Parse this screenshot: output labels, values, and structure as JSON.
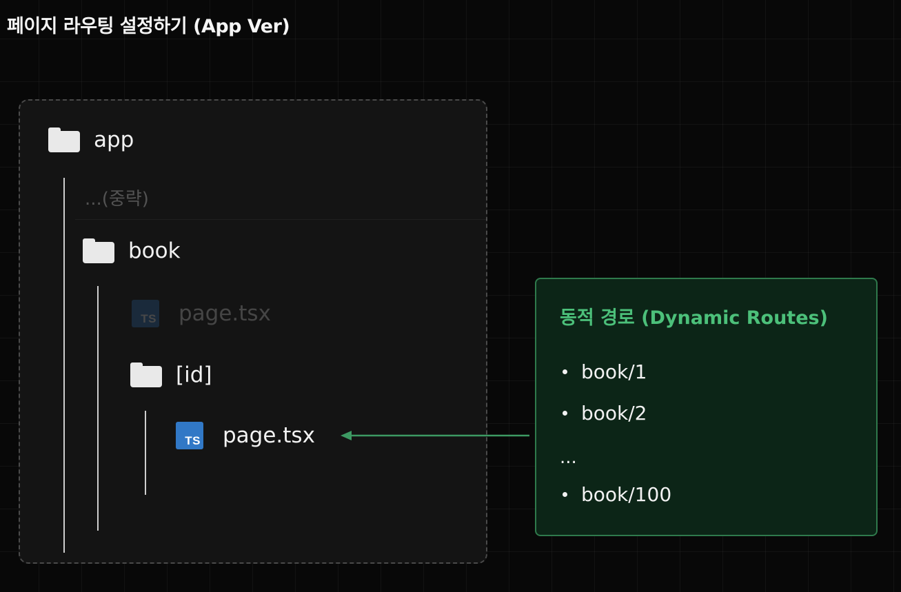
{
  "title": "페이지 라우팅 설정하기 (App Ver)",
  "tree": {
    "app": {
      "label": "app"
    },
    "omitted": {
      "label": "...(중략)"
    },
    "book": {
      "label": "book"
    },
    "book_page": {
      "label": "page.tsx",
      "icon_text": "TS"
    },
    "id_folder": {
      "label": "[id]"
    },
    "id_page": {
      "label": "page.tsx",
      "icon_text": "TS"
    }
  },
  "info_box": {
    "title": "동적 경로 (Dynamic Routes)",
    "items": [
      "book/1",
      "book/2",
      "book/100"
    ],
    "ellipsis": "..."
  },
  "colors": {
    "accent_green": "#4cc07a",
    "box_border": "#2f7a4c",
    "box_background": "#0c2517",
    "ts_blue": "#3178c6",
    "arrow": "#3d9a63"
  },
  "icons": {
    "folder": "folder-icon",
    "typescript_file": "typescript-file-icon"
  }
}
